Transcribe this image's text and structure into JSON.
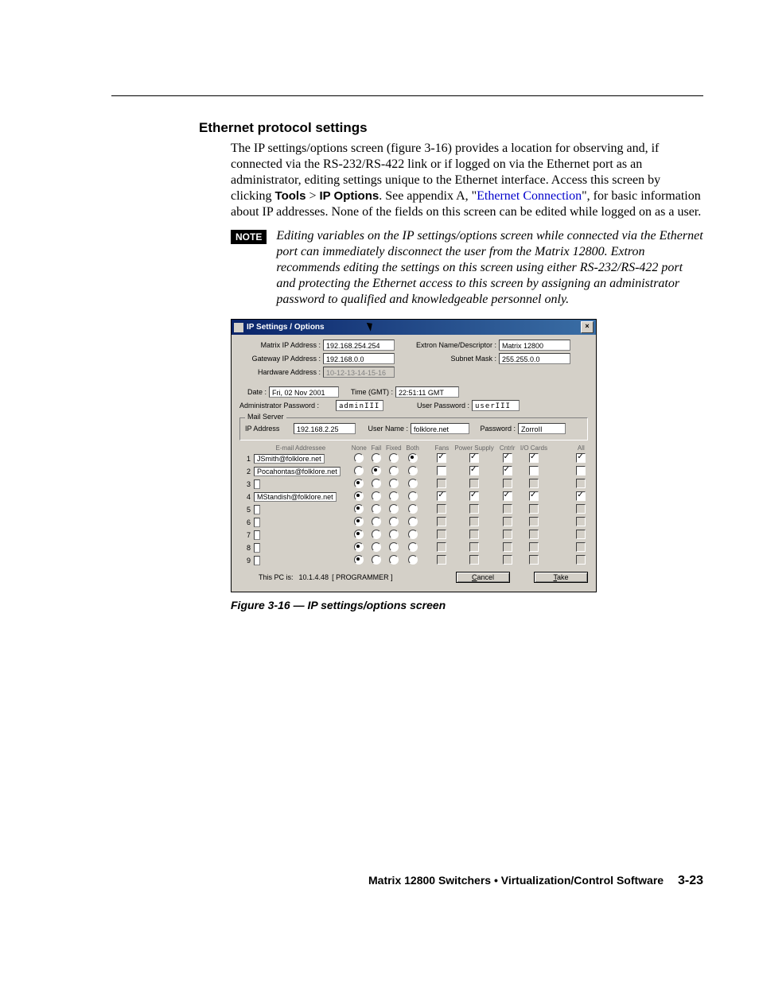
{
  "heading": "Ethernet protocol settings",
  "para1_a": "The IP settings/options screen (figure 3-16) provides a location for observing and, if connected via the RS-232/RS-422 link or if logged on via the Ethernet port as an administrator, editing settings unique to the Ethernet interface.  Access this screen by clicking ",
  "para1_tools": "Tools",
  "para1_gt": " > ",
  "para1_ip": "IP Options",
  "para1_b": ".  See appendix A, \"",
  "para1_link": "Ethernet Connection",
  "para1_c": "\", for basic information about IP addresses.  None of the fields on this screen can be edited while logged on as a user.",
  "note_label": "NOTE",
  "note_text": "Editing variables on the IP settings/options screen while connected via the Ethernet port can immediately disconnect the user from the Matrix 12800. Extron recommends editing the settings on this screen using either RS-232/RS-422 port and protecting the Ethernet access to this screen by assigning an administrator password to qualified and knowledgeable personnel only.",
  "caption": "Figure 3-16 — IP settings/options screen",
  "footer_text": "Matrix 12800 Switchers • Virtualization/Control Software",
  "page_num": "3-23",
  "win": {
    "title": "IP Settings / Options",
    "close": "×",
    "labels": {
      "matrix_ip": "Matrix IP Address :",
      "gateway_ip": "Gateway IP Address :",
      "hardware": "Hardware Address :",
      "extron_name": "Extron Name/Descriptor :",
      "subnet": "Subnet Mask :",
      "date": "Date :",
      "time": "Time (GMT) :",
      "admin_pw": "Administrator Password :",
      "user_pw": "User Password :",
      "mail_server": "Mail Server",
      "mail_ip": "IP Address",
      "user_name": "User Name :",
      "password": "Password :",
      "email_header": "E-mail Addressee",
      "this_pc": "This PC is:",
      "programmer": "[ PROGRAMMER ]"
    },
    "vals": {
      "matrix_ip": "192.168.254.254",
      "gateway_ip": "192.168.0.0",
      "hardware": "10-12-13-14-15-16",
      "extron_name": "Matrix 12800",
      "subnet": "255.255.0.0",
      "date": "Fri, 02 Nov 2001",
      "time": "22:51:11 GMT",
      "admin_pw": "adminIII",
      "user_pw": "userIII",
      "mail_ip": "192.168.2.25",
      "user_name": "folklore.net",
      "password": "ZorroII",
      "this_pc_ip": "10.1.4.48"
    },
    "cols": {
      "none": "None",
      "fail": "Fail",
      "fixed": "Fixed",
      "both": "Both",
      "fans": "Fans",
      "power": "Power\nSupply",
      "cntrlr": "Cntrlr",
      "io": "I/O\nCards",
      "all": "All"
    },
    "rows": [
      {
        "n": "1",
        "addr": "JSmith@folklore.net",
        "radio": 3,
        "fans": true,
        "power": true,
        "cntrlr": true,
        "io": true,
        "all": true,
        "enabled": true
      },
      {
        "n": "2",
        "addr": "Pocahontas@folklore.net",
        "radio": 1,
        "fans": false,
        "power": true,
        "cntrlr": true,
        "io": false,
        "all": false,
        "enabled": true
      },
      {
        "n": "3",
        "addr": "",
        "radio": 0,
        "fans": false,
        "power": false,
        "cntrlr": false,
        "io": false,
        "all": false,
        "enabled": false
      },
      {
        "n": "4",
        "addr": "MStandish@folklore.net",
        "radio": 0,
        "fans": true,
        "power": true,
        "cntrlr": true,
        "io": true,
        "all": true,
        "enabled": true
      },
      {
        "n": "5",
        "addr": "",
        "radio": 0,
        "fans": false,
        "power": false,
        "cntrlr": false,
        "io": false,
        "all": false,
        "enabled": false
      },
      {
        "n": "6",
        "addr": "",
        "radio": 0,
        "fans": false,
        "power": false,
        "cntrlr": false,
        "io": false,
        "all": false,
        "enabled": false
      },
      {
        "n": "7",
        "addr": "",
        "radio": 0,
        "fans": false,
        "power": false,
        "cntrlr": false,
        "io": false,
        "all": false,
        "enabled": false
      },
      {
        "n": "8",
        "addr": "",
        "radio": 0,
        "fans": false,
        "power": false,
        "cntrlr": false,
        "io": false,
        "all": false,
        "enabled": false
      },
      {
        "n": "9",
        "addr": "",
        "radio": 0,
        "fans": false,
        "power": false,
        "cntrlr": false,
        "io": false,
        "all": false,
        "enabled": false
      }
    ],
    "buttons": {
      "cancel": "Cancel",
      "take": "Take"
    }
  }
}
